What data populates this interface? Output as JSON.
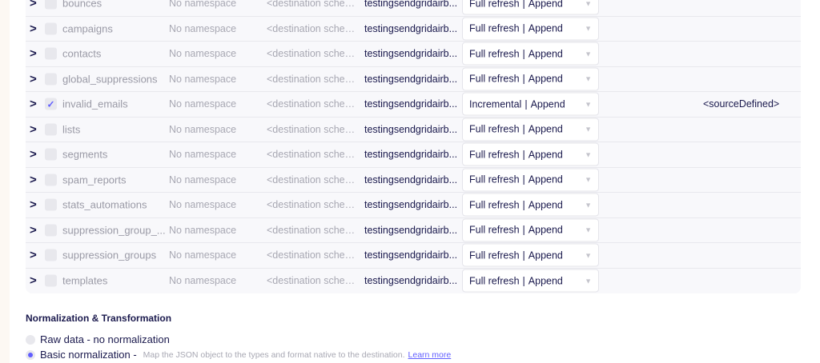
{
  "streams": [
    {
      "name": "bounces",
      "namespace": "No namespace",
      "dest": "<destination schem...",
      "prefix": "testingsendgridairb...",
      "sync_mode": "Full refresh",
      "dest_mode": "Append",
      "checked": false,
      "cursor": ""
    },
    {
      "name": "campaigns",
      "namespace": "No namespace",
      "dest": "<destination schem...",
      "prefix": "testingsendgridairb...",
      "sync_mode": "Full refresh",
      "dest_mode": "Append",
      "checked": false,
      "cursor": ""
    },
    {
      "name": "contacts",
      "namespace": "No namespace",
      "dest": "<destination schem...",
      "prefix": "testingsendgridairb...",
      "sync_mode": "Full refresh",
      "dest_mode": "Append",
      "checked": false,
      "cursor": ""
    },
    {
      "name": "global_suppressions",
      "namespace": "No namespace",
      "dest": "<destination schem...",
      "prefix": "testingsendgridairb...",
      "sync_mode": "Full refresh",
      "dest_mode": "Append",
      "checked": false,
      "cursor": ""
    },
    {
      "name": "invalid_emails",
      "namespace": "No namespace",
      "dest": "<destination schem...",
      "prefix": "testingsendgridairb...",
      "sync_mode": "Incremental",
      "dest_mode": "Append",
      "checked": true,
      "cursor": "<sourceDefined>"
    },
    {
      "name": "lists",
      "namespace": "No namespace",
      "dest": "<destination schem...",
      "prefix": "testingsendgridairb...",
      "sync_mode": "Full refresh",
      "dest_mode": "Append",
      "checked": false,
      "cursor": ""
    },
    {
      "name": "segments",
      "namespace": "No namespace",
      "dest": "<destination schem...",
      "prefix": "testingsendgridairb...",
      "sync_mode": "Full refresh",
      "dest_mode": "Append",
      "checked": false,
      "cursor": ""
    },
    {
      "name": "spam_reports",
      "namespace": "No namespace",
      "dest": "<destination schem...",
      "prefix": "testingsendgridairb...",
      "sync_mode": "Full refresh",
      "dest_mode": "Append",
      "checked": false,
      "cursor": ""
    },
    {
      "name": "stats_automations",
      "namespace": "No namespace",
      "dest": "<destination schem...",
      "prefix": "testingsendgridairb...",
      "sync_mode": "Full refresh",
      "dest_mode": "Append",
      "checked": false,
      "cursor": ""
    },
    {
      "name": "suppression_group_...",
      "namespace": "No namespace",
      "dest": "<destination schem...",
      "prefix": "testingsendgridairb...",
      "sync_mode": "Full refresh",
      "dest_mode": "Append",
      "checked": false,
      "cursor": ""
    },
    {
      "name": "suppression_groups",
      "namespace": "No namespace",
      "dest": "<destination schem...",
      "prefix": "testingsendgridairb...",
      "sync_mode": "Full refresh",
      "dest_mode": "Append",
      "checked": false,
      "cursor": ""
    },
    {
      "name": "templates",
      "namespace": "No namespace",
      "dest": "<destination schem...",
      "prefix": "testingsendgridairb...",
      "sync_mode": "Full refresh",
      "dest_mode": "Append",
      "checked": false,
      "cursor": ""
    }
  ],
  "normalization": {
    "title": "Normalization & Transformation",
    "options": [
      {
        "label": "Raw data - no normalization",
        "selected": false
      },
      {
        "label": "Basic normalization -",
        "selected": true,
        "description": "Map the JSON object to the types and format native to the destination.",
        "link": "Learn more"
      }
    ]
  }
}
